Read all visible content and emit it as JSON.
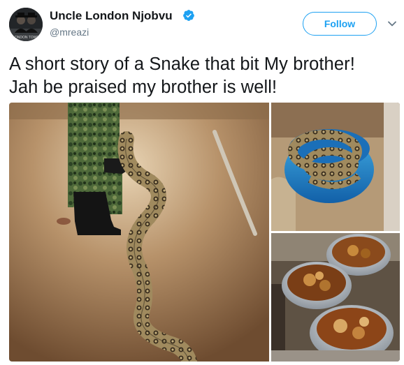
{
  "user": {
    "display_name": "Uncle London Njobvu",
    "handle": "@mreazi",
    "verified": true,
    "avatar_caption": "LONDON TOWN"
  },
  "actions": {
    "follow_label": "Follow",
    "menu_icon": "chevron-down-icon"
  },
  "tweet": {
    "text_line1": "A short story of a Snake that bit My brother!",
    "text_line2": "Jah be praised my brother is well!"
  },
  "media": {
    "photos": [
      {
        "description": "python-on-floor-with-soldier-boots"
      },
      {
        "description": "python-coiled-in-blue-bucket"
      },
      {
        "description": "cooked-meat-in-pots"
      }
    ]
  },
  "colors": {
    "accent": "#1da1f2",
    "text": "#14171a",
    "secondary": "#657786"
  }
}
